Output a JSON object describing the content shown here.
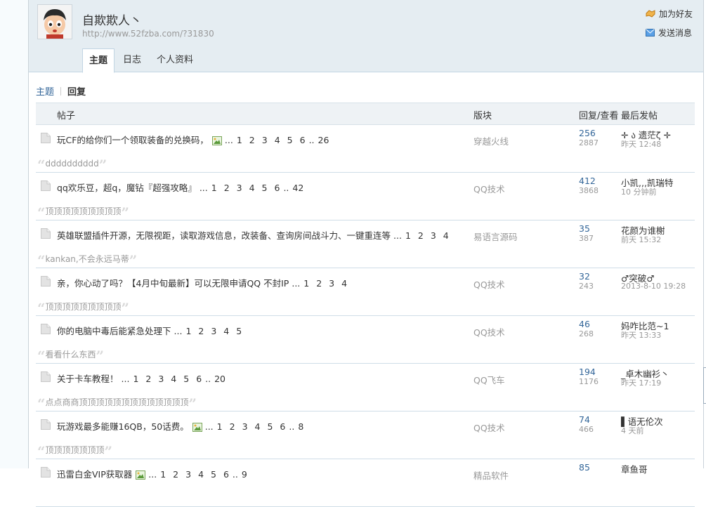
{
  "profile": {
    "name": "自欺欺人丶",
    "url": "http://www.52fzba.com/?31830"
  },
  "actions": {
    "add_friend": "加为好友",
    "send_message": "发送消息"
  },
  "tabs": [
    "主题",
    "日志",
    "个人资料"
  ],
  "subnav": {
    "topic": "主题",
    "reply": "回复"
  },
  "table": {
    "col_post": "帖子",
    "col_forum": "版块",
    "col_stats": "回复/查看",
    "col_last": "最后发帖"
  },
  "rows": [
    {
      "title": "玩CF的给你们一个领取装备的兑换码，",
      "img": true,
      "ellipsis": "...",
      "pages": [
        "1",
        "2",
        "3",
        "4",
        "5",
        "6"
      ],
      "dots": "..",
      "last_page": "26",
      "quote": "dddddddddd",
      "forum": "穿越火线",
      "replies": "256",
      "views": "2887",
      "last_user": "✛ ა 遗茫ζ ✛",
      "last_time": "昨天 12:48"
    },
    {
      "title": "qq欢乐豆，超q，魔钻『超强攻略』",
      "img": false,
      "ellipsis": "...",
      "pages": [
        "1",
        "2",
        "3",
        "4",
        "5",
        "6"
      ],
      "dots": "..",
      "last_page": "42",
      "quote": "顶顶顶顶顶顶顶顶顶",
      "forum": "QQ技术",
      "replies": "412",
      "views": "3868",
      "last_user": "小凯,,,凯瑞特",
      "last_time": "10 分钟前"
    },
    {
      "title": "英雄联盟插件开源，无限视距，读取游戏信息，改装备、查询房间战斗力、一键重连等",
      "img": false,
      "ellipsis": "...",
      "pages": [
        "1",
        "2",
        "3",
        "4"
      ],
      "dots": "",
      "last_page": "",
      "quote": "kankan,不会永远马蒂",
      "forum": "易语言源码",
      "replies": "35",
      "views": "387",
      "last_user": "花颜为谁榭",
      "last_time": "前天 15:32"
    },
    {
      "title": "亲，你心动了吗？【4月中旬最新】可以无限申请QQ 不封IP",
      "img": false,
      "ellipsis": "...",
      "pages": [
        "1",
        "2",
        "3",
        "4"
      ],
      "dots": "",
      "last_page": "",
      "quote": "顶顶顶顶顶顶顶顶顶",
      "forum": "QQ技术",
      "replies": "32",
      "views": "243",
      "last_user": "♂突破♂",
      "last_time": "2013-8-10 19:28"
    },
    {
      "title": "你的电脑中毒后能紧急处理下",
      "img": false,
      "ellipsis": "...",
      "pages": [
        "1",
        "2",
        "3",
        "4",
        "5"
      ],
      "dots": "",
      "last_page": "",
      "quote": "看看什么东西",
      "forum": "QQ技术",
      "replies": "46",
      "views": "268",
      "last_user": "妈咋比范~1",
      "last_time": "昨天 13:33"
    },
    {
      "title": "关于卡车教程！",
      "img": false,
      "ellipsis": "...",
      "pages": [
        "1",
        "2",
        "3",
        "4",
        "5",
        "6"
      ],
      "dots": "..",
      "last_page": "20",
      "quote": "点点商商顶顶顶顶顶顶顶顶顶顶顶顶顶",
      "forum": "QQ飞车",
      "replies": "194",
      "views": "1176",
      "last_user": "_卓木幽衫丶",
      "last_time": "昨天 17:19"
    },
    {
      "title": "玩游戏最多能赚16QB，50话费。",
      "img": true,
      "ellipsis": "...",
      "pages": [
        "1",
        "2",
        "3",
        "4",
        "5",
        "6"
      ],
      "dots": "..",
      "last_page": "8",
      "quote": "顶顶顶顶顶顶顶",
      "forum": "QQ技术",
      "replies": "74",
      "views": "466",
      "last_user": "▌语无伦次",
      "last_time": "4 天前"
    },
    {
      "title": "迅雷白金VIP获取器",
      "img": true,
      "ellipsis": "...",
      "pages": [
        "1",
        "2",
        "3",
        "4",
        "5",
        "6"
      ],
      "dots": "..",
      "last_page": "9",
      "quote": "",
      "forum": "精品软件",
      "replies": "85",
      "views": "",
      "last_user": "章鱼哥",
      "last_time": ""
    }
  ],
  "colors": {
    "link": "#336699",
    "muted": "#999999",
    "header_bg": "#e5edf2"
  }
}
